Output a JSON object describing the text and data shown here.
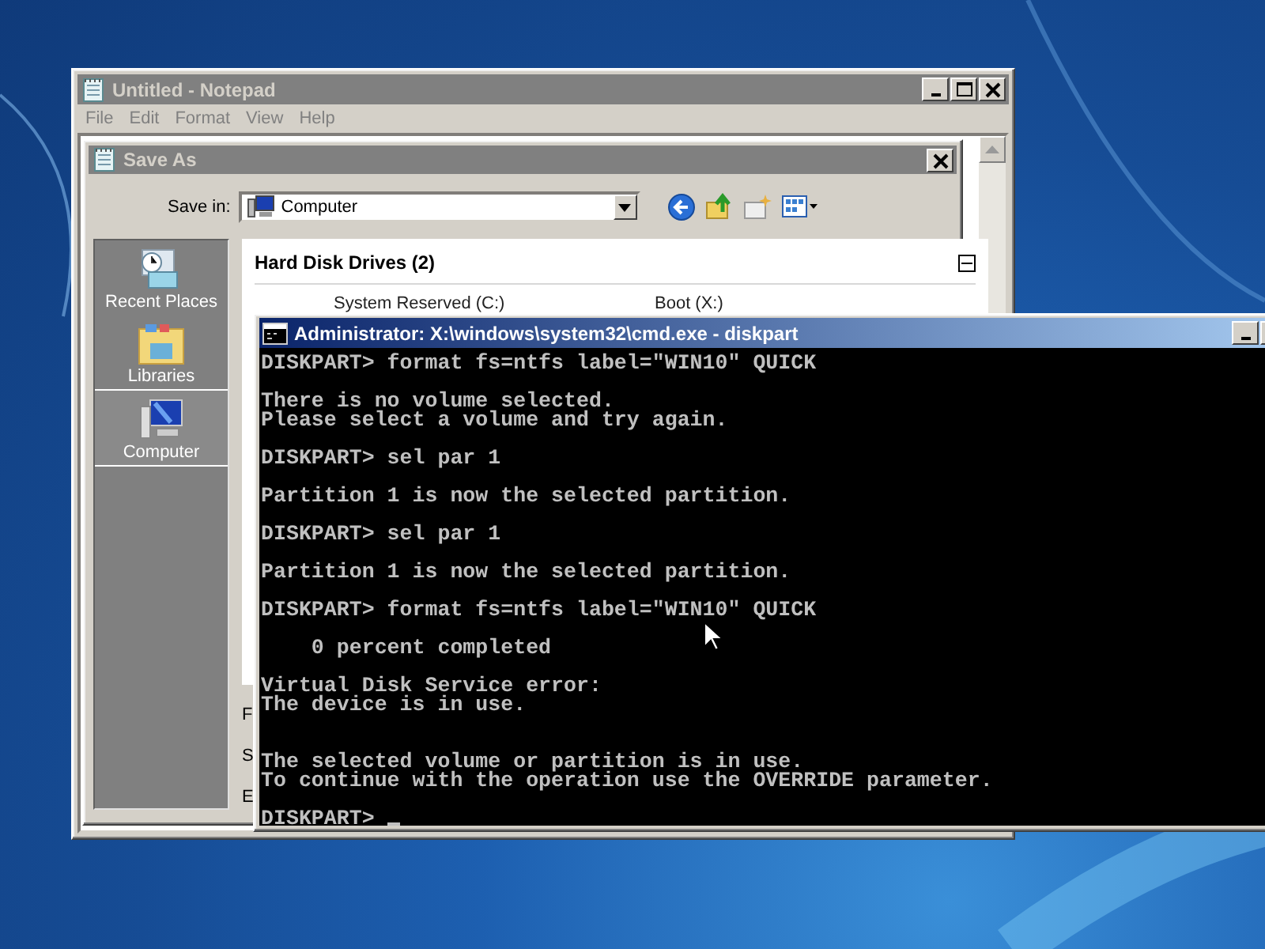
{
  "notepad": {
    "title": "Untitled - Notepad",
    "menu": [
      "File",
      "Edit",
      "Format",
      "View",
      "Help"
    ]
  },
  "save_as": {
    "title": "Save As",
    "save_in_label": "Save in:",
    "location": "Computer",
    "places": [
      {
        "label": "Recent Places",
        "kind": "recent",
        "selected": false
      },
      {
        "label": "Libraries",
        "kind": "libraries",
        "selected": false
      },
      {
        "label": "Computer",
        "kind": "computer",
        "selected": true
      }
    ],
    "group": {
      "title": "Hard Disk Drives (2)",
      "expanded": true,
      "items": [
        "System Reserved (C:)",
        "Boot (X:)"
      ]
    },
    "field_labels": [
      "F",
      "S",
      "E"
    ]
  },
  "console": {
    "title": "Administrator: X:\\windows\\system32\\cmd.exe - diskpart",
    "blocks": [
      {
        "lines": [
          "DISKPART> format fs=ntfs label=\"WIN10\" QUICK"
        ],
        "wide_gap": false
      },
      {
        "lines": [
          "There is no volume selected.",
          "Please select a volume and try again."
        ],
        "wide_gap": false
      },
      {
        "lines": [
          "DISKPART> sel par 1"
        ],
        "wide_gap": false
      },
      {
        "lines": [
          "Partition 1 is now the selected partition."
        ],
        "wide_gap": false
      },
      {
        "lines": [
          "DISKPART> sel par 1"
        ],
        "wide_gap": false
      },
      {
        "lines": [
          "Partition 1 is now the selected partition."
        ],
        "wide_gap": false
      },
      {
        "lines": [
          "DISKPART> format fs=ntfs label=\"WIN10\" QUICK"
        ],
        "wide_gap": false
      },
      {
        "lines": [
          "    0 percent completed"
        ],
        "wide_gap": false
      },
      {
        "lines": [
          "Virtual Disk Service error:",
          "The device is in use."
        ],
        "wide_gap": true
      },
      {
        "lines": [
          "The selected volume or partition is in use.",
          "To continue with the operation use the OVERRIDE parameter."
        ],
        "wide_gap": false
      }
    ],
    "prompt": "DISKPART>"
  }
}
